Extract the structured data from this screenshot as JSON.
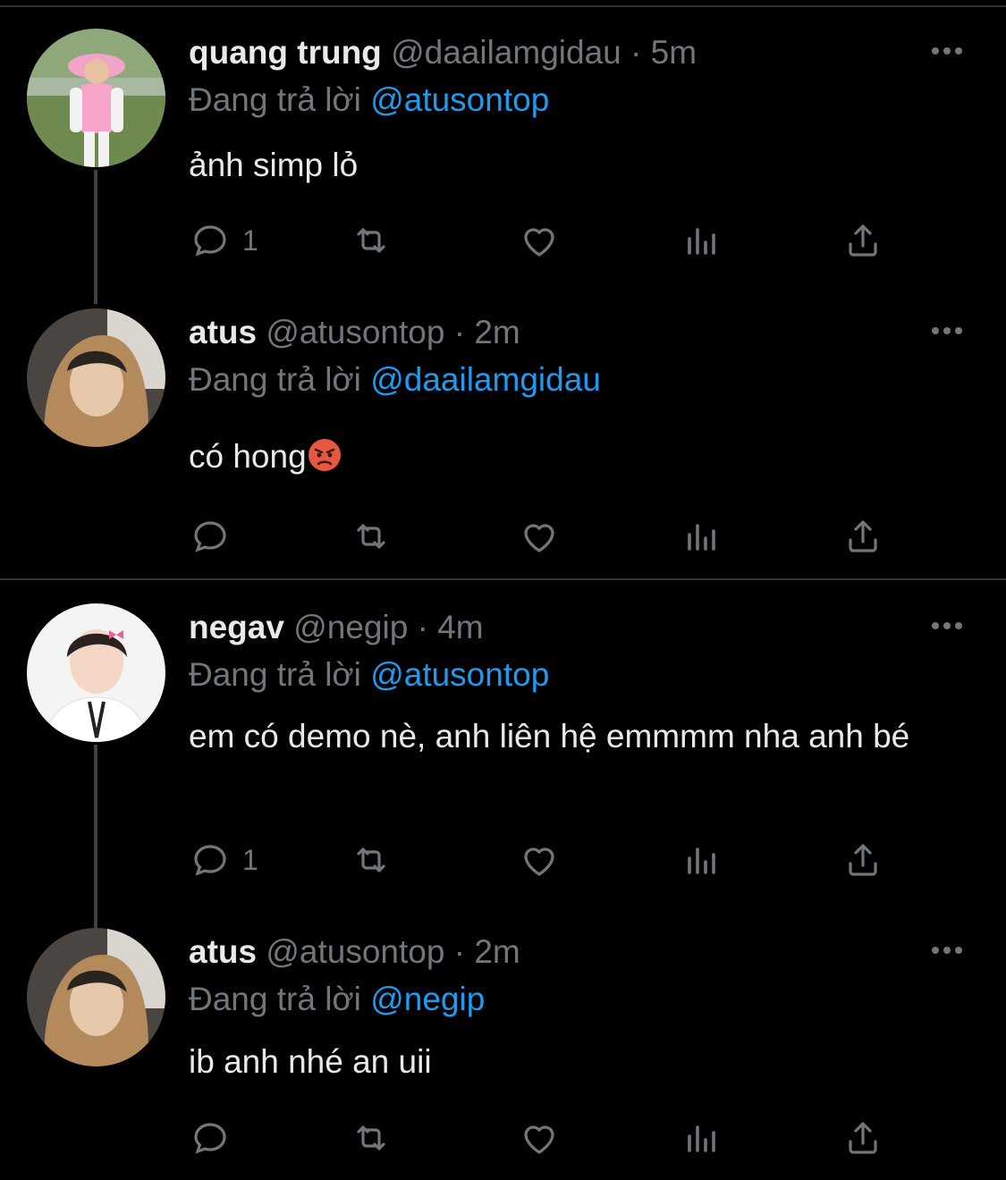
{
  "tweets": [
    {
      "name": "quang trung",
      "handle": "@daailamgidau",
      "time": "5m",
      "replying_prefix": "Đang trả lời",
      "replying_to": "@atusontop",
      "text": "ảnh simp lỏ",
      "reply_count": "1"
    },
    {
      "name": "atus",
      "handle": "@atusontop",
      "time": "2m",
      "replying_prefix": "Đang trả lời",
      "replying_to": "@daailamgidau",
      "text": "có hong",
      "reply_count": ""
    },
    {
      "name": "negav",
      "handle": "@negip",
      "time": "4m",
      "replying_prefix": "Đang trả lời",
      "replying_to": "@atusontop",
      "text": "em có demo nè, anh liên hệ emmmm nha anh bé",
      "reply_count": "1"
    },
    {
      "name": "atus",
      "handle": "@atusontop",
      "time": "2m",
      "replying_prefix": "Đang trả lời",
      "replying_to": "@negip",
      "text": "ib anh nhé an uii",
      "reply_count": ""
    }
  ],
  "separator": "·",
  "icons": [
    "reply-icon",
    "retweet-icon",
    "like-icon",
    "views-icon",
    "share-icon",
    "more-icon",
    "angry-face-emoji"
  ],
  "colors": {
    "background": "#000000",
    "text": "#e7e9ea",
    "muted": "#71767b",
    "link": "#1d9bf0"
  }
}
